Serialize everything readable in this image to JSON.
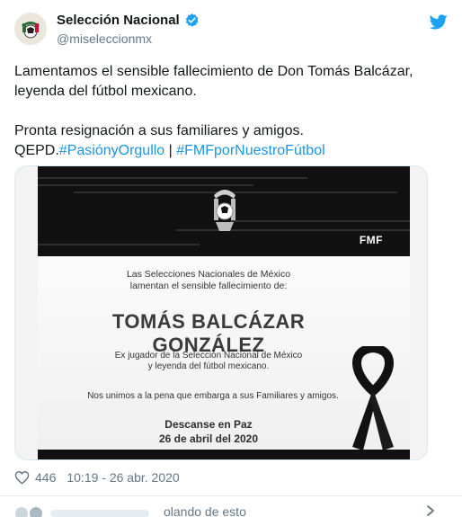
{
  "account": {
    "name": "Selección Nacional",
    "handle": "@miseleccionmx",
    "verified": true,
    "icons": {
      "avatar": "fmf-crest-avatar",
      "verified": "verified-badge-icon",
      "platform": "twitter-bird-icon"
    }
  },
  "tweet": {
    "line1": "Lamentamos el sensible fallecimiento de Don Tomás Balcázar,",
    "line2": "leyenda del fútbol mexicano.",
    "line3": "Pronta resignación a sus familiares y amigos.",
    "qepd": "QEPD.",
    "hashtag1": "#PasiónyOrgullo",
    "separator": " | ",
    "hashtag2": "#FMFporNuestroFútbol"
  },
  "image": {
    "brand": "FMF",
    "intro_line1": "Las Selecciones Nacionales de México",
    "intro_line2": "lamentan el sensible fallecimiento de:",
    "person_name": "TOMÁS BALCÁZAR GONZÁLEZ",
    "career_line1": "Ex jugador de la Selección Nacional de México",
    "career_line2": "y leyenda del fútbol mexicano.",
    "condolence": "Nos unimos a la pena que embarga a sus Familiares y amigos.",
    "rest": "Descanse en Paz",
    "date": "26 de abril del 2020"
  },
  "meta": {
    "likes": "446",
    "timestamp": "10:19 - 26 abr. 2020"
  },
  "replies": {
    "text": "olando de esto"
  },
  "colors": {
    "link": "#1b95e0",
    "verified": "#1da1f2",
    "secondary": "#657786",
    "banner": "#111111"
  }
}
